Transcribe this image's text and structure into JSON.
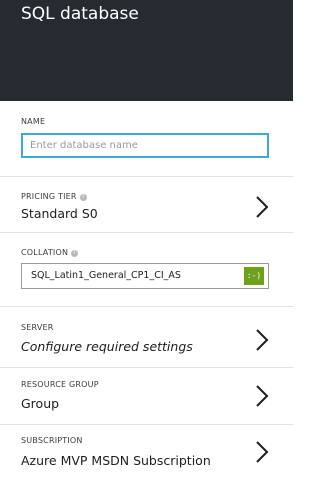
{
  "header": {
    "title": "SQL database"
  },
  "name_field": {
    "label": "NAME",
    "placeholder": "Enter database name",
    "value": ""
  },
  "pricing_tier": {
    "label": "PRICING TIER",
    "value": "Standard S0"
  },
  "collation": {
    "label": "COLLATION",
    "value": "SQL_Latin1_General_CP1_CI_AS",
    "status_badge": ":-)",
    "badge_color": "#6fa21a"
  },
  "server": {
    "label": "SERVER",
    "value": "Configure required settings"
  },
  "resource_group": {
    "label": "RESOURCE GROUP",
    "value": "Group"
  },
  "subscription": {
    "label": "SUBSCRIPTION",
    "value": "Azure MVP MSDN Subscription"
  },
  "colors": {
    "header_bg": "#262a31",
    "accent": "#3ea9d8"
  }
}
